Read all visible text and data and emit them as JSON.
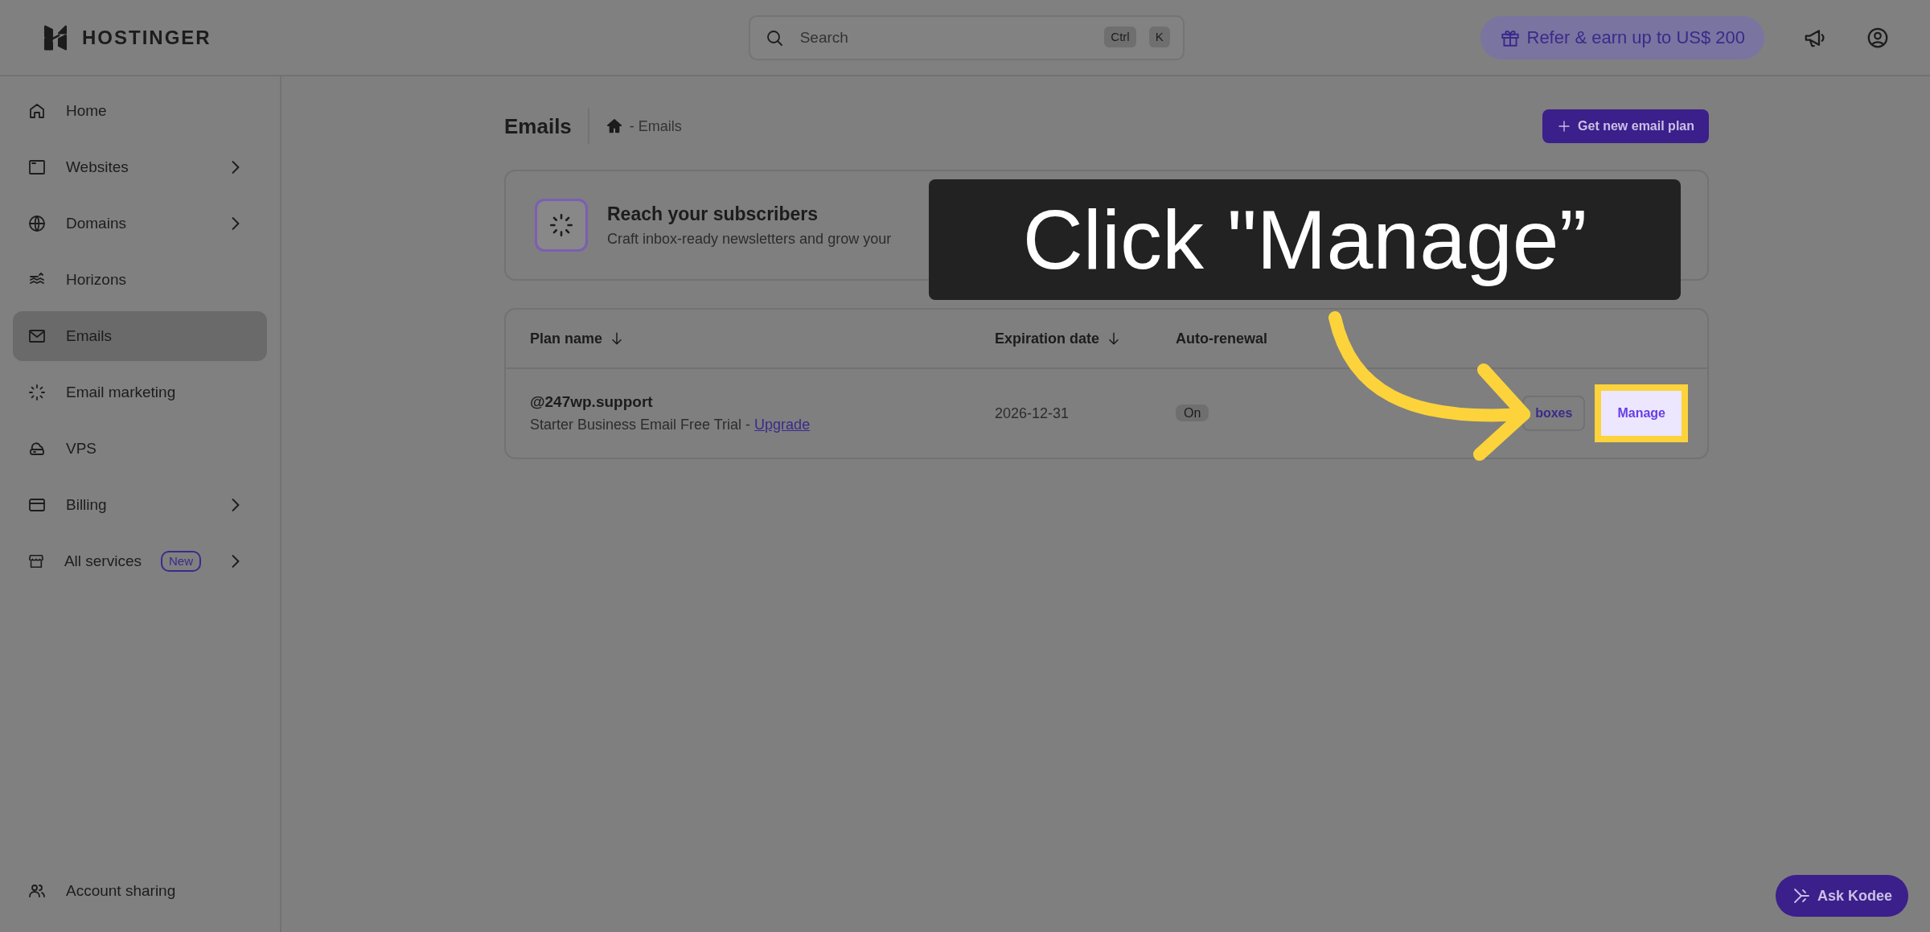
{
  "header": {
    "logo": "HOSTINGER",
    "search": {
      "placeholder": "Search",
      "shortcut": [
        "Ctrl",
        "K"
      ]
    },
    "referral": "Refer & earn up to US$ 200"
  },
  "sidebar": {
    "items": [
      {
        "label": "Home",
        "selected": false,
        "expandable": false
      },
      {
        "label": "Websites",
        "selected": false,
        "expandable": true
      },
      {
        "label": "Domains",
        "selected": false,
        "expandable": true
      },
      {
        "label": "Horizons",
        "selected": false,
        "expandable": false
      },
      {
        "label": "Emails",
        "selected": true,
        "expandable": false
      },
      {
        "label": "Email marketing",
        "selected": false,
        "expandable": false
      },
      {
        "label": "VPS",
        "selected": false,
        "expandable": false
      },
      {
        "label": "Billing",
        "selected": false,
        "expandable": true
      },
      {
        "label": "All services",
        "selected": false,
        "expandable": true,
        "badge": "New"
      }
    ],
    "footer_item": {
      "label": "Account sharing"
    }
  },
  "page": {
    "title": "Emails",
    "breadcrumb": "- Emails",
    "primary_button": "Get new email plan"
  },
  "promo": {
    "title": "Reach your subscribers",
    "text": "Craft inbox-ready newsletters and grow your"
  },
  "table": {
    "columns": [
      {
        "label": "Plan name",
        "sortable": true
      },
      {
        "label": "Expiration date",
        "sortable": true
      },
      {
        "label": "Auto-renewal",
        "sortable": false
      }
    ],
    "rows": [
      {
        "name": "@247wp.support",
        "plan": "Starter Business Email Free Trial -",
        "link": "Upgrade",
        "expiration": "2026-12-31",
        "auto_renewal": "On",
        "actions": [
          {
            "label": "boxes",
            "highlighted": false
          },
          {
            "label": "Manage",
            "highlighted": true
          }
        ]
      }
    ]
  },
  "callout": {
    "text": "Click \"Manage”"
  },
  "assistant_button": "Ask Kodee"
}
